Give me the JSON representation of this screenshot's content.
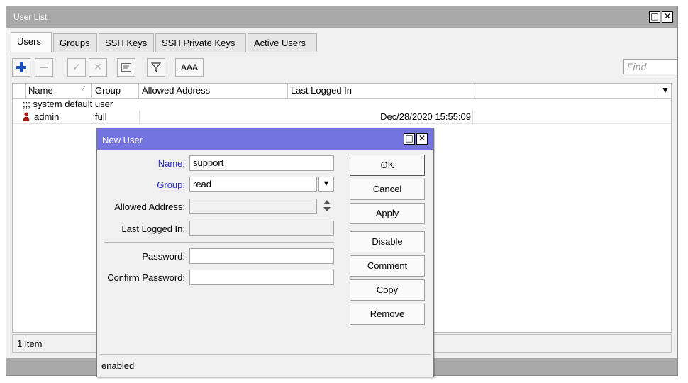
{
  "window": {
    "title": "User List"
  },
  "tabs": [
    {
      "label": "Users",
      "active": true
    },
    {
      "label": "Groups"
    },
    {
      "label": "SSH Keys"
    },
    {
      "label": "SSH Private Keys"
    },
    {
      "label": "Active Users"
    }
  ],
  "toolbar": {
    "aaa_label": "AAA",
    "find_placeholder": "Find",
    "icons": [
      "plus-icon",
      "minus-icon",
      "check-icon",
      "x-icon",
      "comment-icon",
      "filter-icon"
    ]
  },
  "table": {
    "columns": [
      "Name",
      "Group",
      "Allowed Address",
      "Last Logged In"
    ],
    "section_comment": ";;; system default user",
    "rows": [
      {
        "name": "admin",
        "group": "full",
        "allowed_address": "",
        "last_logged_in": "Dec/28/2020 15:55:09"
      }
    ],
    "footer": "1 item"
  },
  "dialog": {
    "title": "New User",
    "fields": {
      "name_label": "Name:",
      "name_value": "support",
      "group_label": "Group:",
      "group_value": "read",
      "allowed_address_label": "Allowed Address:",
      "allowed_address_value": "",
      "last_logged_in_label": "Last Logged In:",
      "last_logged_in_value": "",
      "password_label": "Password:",
      "password_value": "",
      "confirm_password_label": "Confirm Password:",
      "confirm_password_value": ""
    },
    "buttons": {
      "ok": "OK",
      "cancel": "Cancel",
      "apply": "Apply",
      "disable": "Disable",
      "comment": "Comment",
      "copy": "Copy",
      "remove": "Remove"
    },
    "status": "enabled"
  },
  "colors": {
    "dialog_title": "#7474e0",
    "label_blue": "#2a2ad6",
    "window_title": "#a9a9a9",
    "user_icon": "#b01818"
  }
}
